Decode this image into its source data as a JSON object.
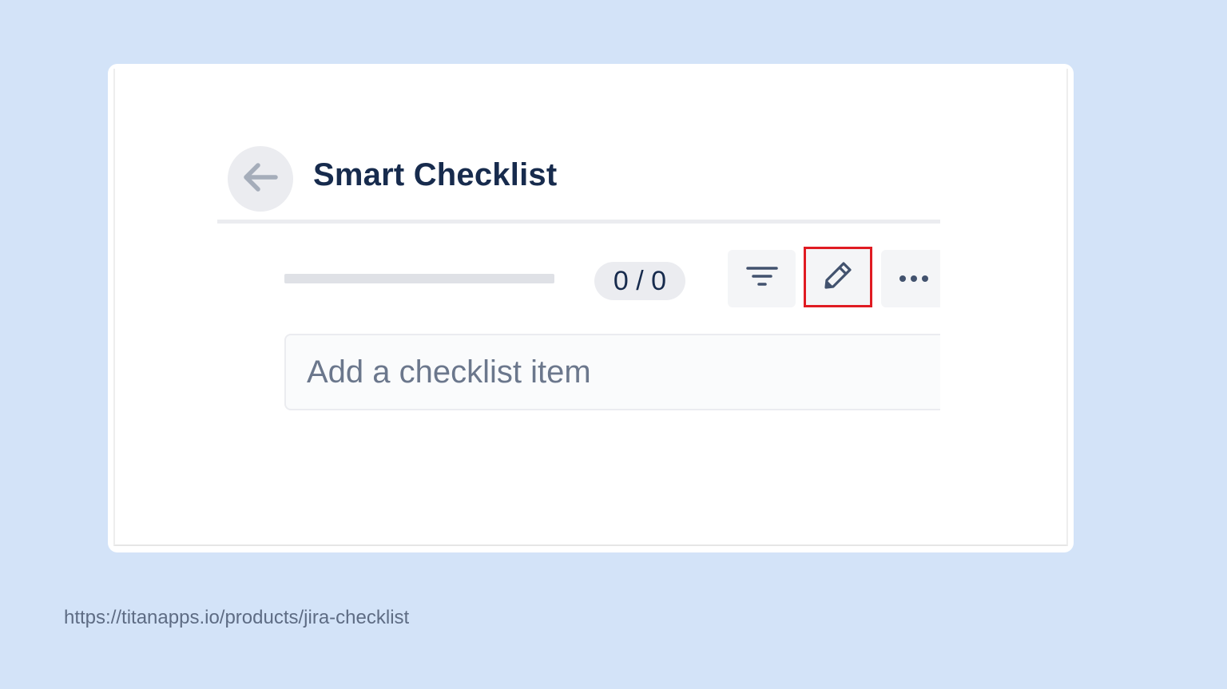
{
  "header": {
    "back_icon": "arrow-left-icon",
    "title": "Smart Checklist"
  },
  "toolbar": {
    "progress_fraction": 0,
    "count_label": "0 / 0",
    "filter_icon": "filter-icon",
    "edit_icon": "pencil-icon",
    "edit_highlight_color": "#e01b22",
    "more_icon": "more-horizontal-icon"
  },
  "add_item": {
    "placeholder": "Add a checklist item",
    "value": ""
  },
  "footer": {
    "source_url": "https://titanapps.io/products/jira-checklist"
  },
  "colors": {
    "background": "#d3e3f8",
    "title_text": "#172b4d",
    "muted_text": "#6b778c",
    "button_bg": "#f4f5f7",
    "highlight": "#e01b22"
  }
}
